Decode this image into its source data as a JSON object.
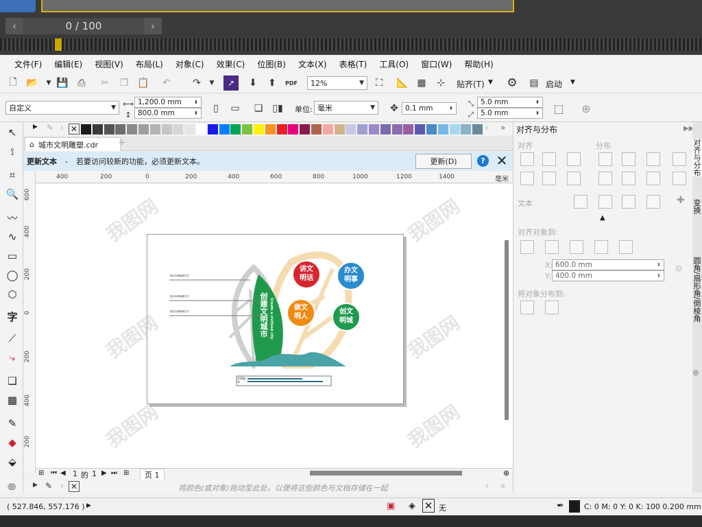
{
  "pager": {
    "text": "0  /  100",
    "prev": "‹",
    "next": "›"
  },
  "menu": [
    "文件(F)",
    "编辑(E)",
    "视图(V)",
    "布局(L)",
    "对象(C)",
    "效果(C)",
    "位图(B)",
    "文本(X)",
    "表格(T)",
    "工具(O)",
    "窗口(W)",
    "帮助(H)"
  ],
  "toolbar": {
    "zoom": "12%",
    "snap_label": "贴齐(T)",
    "launch_label": "启动",
    "pdf": "PDF"
  },
  "propbar": {
    "preset": "自定义",
    "width": "1,200.0 mm",
    "height": "800.0 mm",
    "units_label": "单位:",
    "units": "毫米",
    "nudge": "0.1 mm",
    "dup_x": "5.0 mm",
    "dup_y": "5.0 mm"
  },
  "palette_colors": [
    "#1a1a1a",
    "#3a3a3a",
    "#555",
    "#6e6e6e",
    "#8a8a8a",
    "#a0a0a0",
    "#b4b4b4",
    "#c6c6c6",
    "#d6d6d6",
    "#e6e6e6",
    "#ffffff",
    "#1a1ae6",
    "#0080ff",
    "#00a651",
    "#7cc242",
    "#fff200",
    "#f7941d",
    "#ed1c24",
    "#e6007e",
    "#8b1a4a",
    "#b0644a",
    "#f5a6a6",
    "#d2b48c",
    "#c8c8e6",
    "#a0a0d2",
    "#9b8ac8",
    "#7b6ab0",
    "#8c6ab4",
    "#9a5fa0",
    "#5a5ab4",
    "#4a8ac8",
    "#7ab8e6",
    "#a8d8f0",
    "#8ab4c8",
    "#6a8a9a"
  ],
  "doc_tab": "城市文明雕塑.cdr",
  "notice": {
    "title": "更新文本",
    "dash": "-",
    "message": "若要访问较新的功能，必须更新文本。",
    "button": "更新(D)",
    "help": "?"
  },
  "ruler": {
    "h_ticks": [
      "400",
      "200",
      "0",
      "200",
      "400",
      "600",
      "800",
      "1000",
      "1200",
      "1400"
    ],
    "unit": "毫米",
    "v_ticks": [
      "600",
      "400",
      "200",
      "0",
      "200",
      "400",
      "600",
      "800",
      "200"
    ]
  },
  "artwork": {
    "bubbles": [
      {
        "text1": "讲文",
        "text2": "明话",
        "color": "#d7262f"
      },
      {
        "text1": "办文",
        "text2": "明事",
        "color": "#2a8ad0"
      },
      {
        "text1": "做文",
        "text2": "明人",
        "color": "#f08a12"
      },
      {
        "text1": "创文",
        "text2": "明城",
        "color": "#1f9a4c"
      }
    ],
    "vertical_title": "创建文明城市",
    "vertical_en": "Create a civilized city",
    "leaders": [
      "路名标牌编辑文字",
      "路名标牌编辑文字",
      "路名标牌编辑文字"
    ],
    "plaque_label": "文明城市",
    "colors": {
      "green": "#1f9a4c",
      "leaf": "#f5dcb0",
      "grey": "#cfcfcf",
      "wave": "#4aa3a6"
    }
  },
  "page_nav": {
    "current": "1",
    "of": "的",
    "total": "1",
    "tab": "页 1"
  },
  "bottom_palette_hint": "将颜色(或对象)拖动至此处，以便将这些颜色与文档存储在一起",
  "status": {
    "coords": "( 527.846, 557.176 )",
    "fill_none": "无",
    "color_info": "C: 0 M: 0 Y: 0 K: 100  0.200 mm"
  },
  "panel": {
    "title": "对齐与分布",
    "align": "对齐",
    "distribute": "分布",
    "text": "文本",
    "align_to": "对齐对象到:",
    "x": "600.0 mm",
    "y": "400.0 mm",
    "x_label": "X:",
    "y_label": "Y:",
    "distribute_to": "将对象分布到:"
  },
  "side_tabs": [
    "对齐与分布",
    "变换",
    "圆角/扇形角/倒棱角"
  ],
  "watermark": "我图网"
}
